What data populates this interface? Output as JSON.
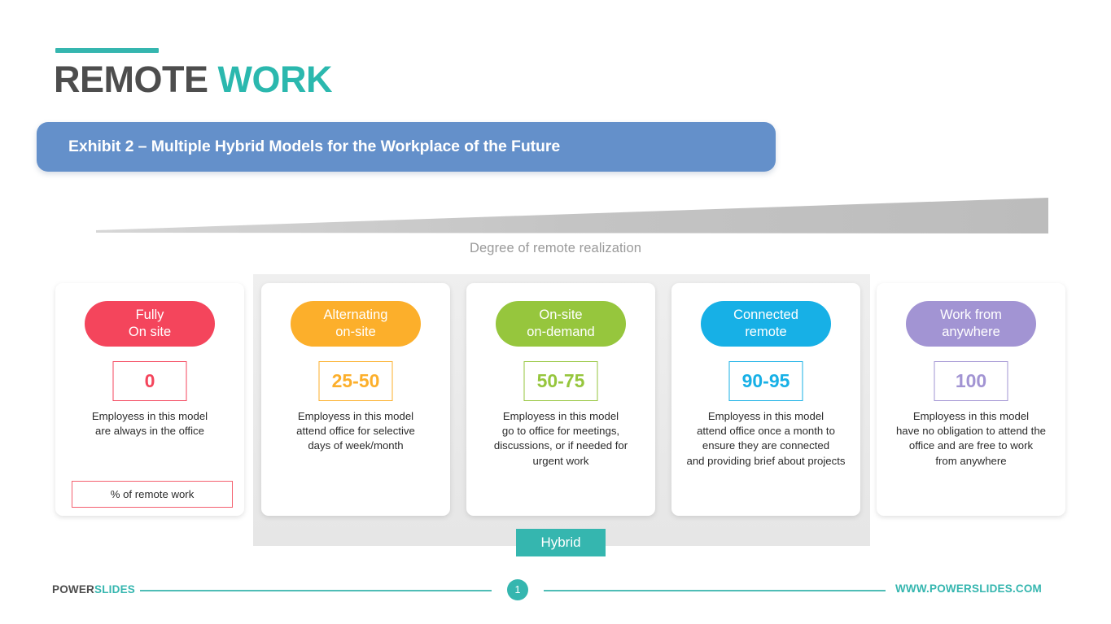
{
  "header": {
    "title_part1": "REMOTE",
    "title_part2": "WORK",
    "banner_text": "Exhibit 2 – Multiple Hybrid Models for the Workplace of the Future",
    "accent_color": "#35B6AF",
    "banner_color": "#6490CA"
  },
  "axis": {
    "label": "Degree of remote realization",
    "wedge_color": "#BEBEBE"
  },
  "legend": {
    "remote_work_label": "% of remote work",
    "hybrid_label": "Hybrid",
    "hybrid_color": "#35B6AF"
  },
  "cards": [
    {
      "title_line1": "Fully",
      "title_line2": "On site",
      "value": "0",
      "description": "Employess in this model\nare always in the office",
      "color": "#F4455C"
    },
    {
      "title_line1": "Alternating",
      "title_line2": "on-site",
      "value": "25-50",
      "description": "Employess in this model\nattend office for selective\ndays of week/month",
      "color": "#FCAF2B"
    },
    {
      "title_line1": "On-site",
      "title_line2": "on-demand",
      "value": "50-75",
      "description": "Employess in this model\ngo to office for meetings,\ndiscussions,  or if needed for\nurgent work",
      "color": "#96C63D"
    },
    {
      "title_line1": "Connected",
      "title_line2": "remote",
      "value": "90-95",
      "description": "Employess in this model\nattend office once a month to\nensure they are connected\nand providing brief about projects",
      "color": "#17B0E6"
    },
    {
      "title_line1": "Work from",
      "title_line2": "anywhere",
      "value": "100",
      "description": "Employess in this model\nhave no obligation to attend the\noffice and are free to work\nfrom anywhere",
      "color": "#A294D3"
    }
  ],
  "footer": {
    "brand_part1": "POWER",
    "brand_part2": "SLIDES",
    "page_number": "1",
    "url": "WWW.POWERSLIDES.COM",
    "rule_color": "#4FBDB6"
  }
}
